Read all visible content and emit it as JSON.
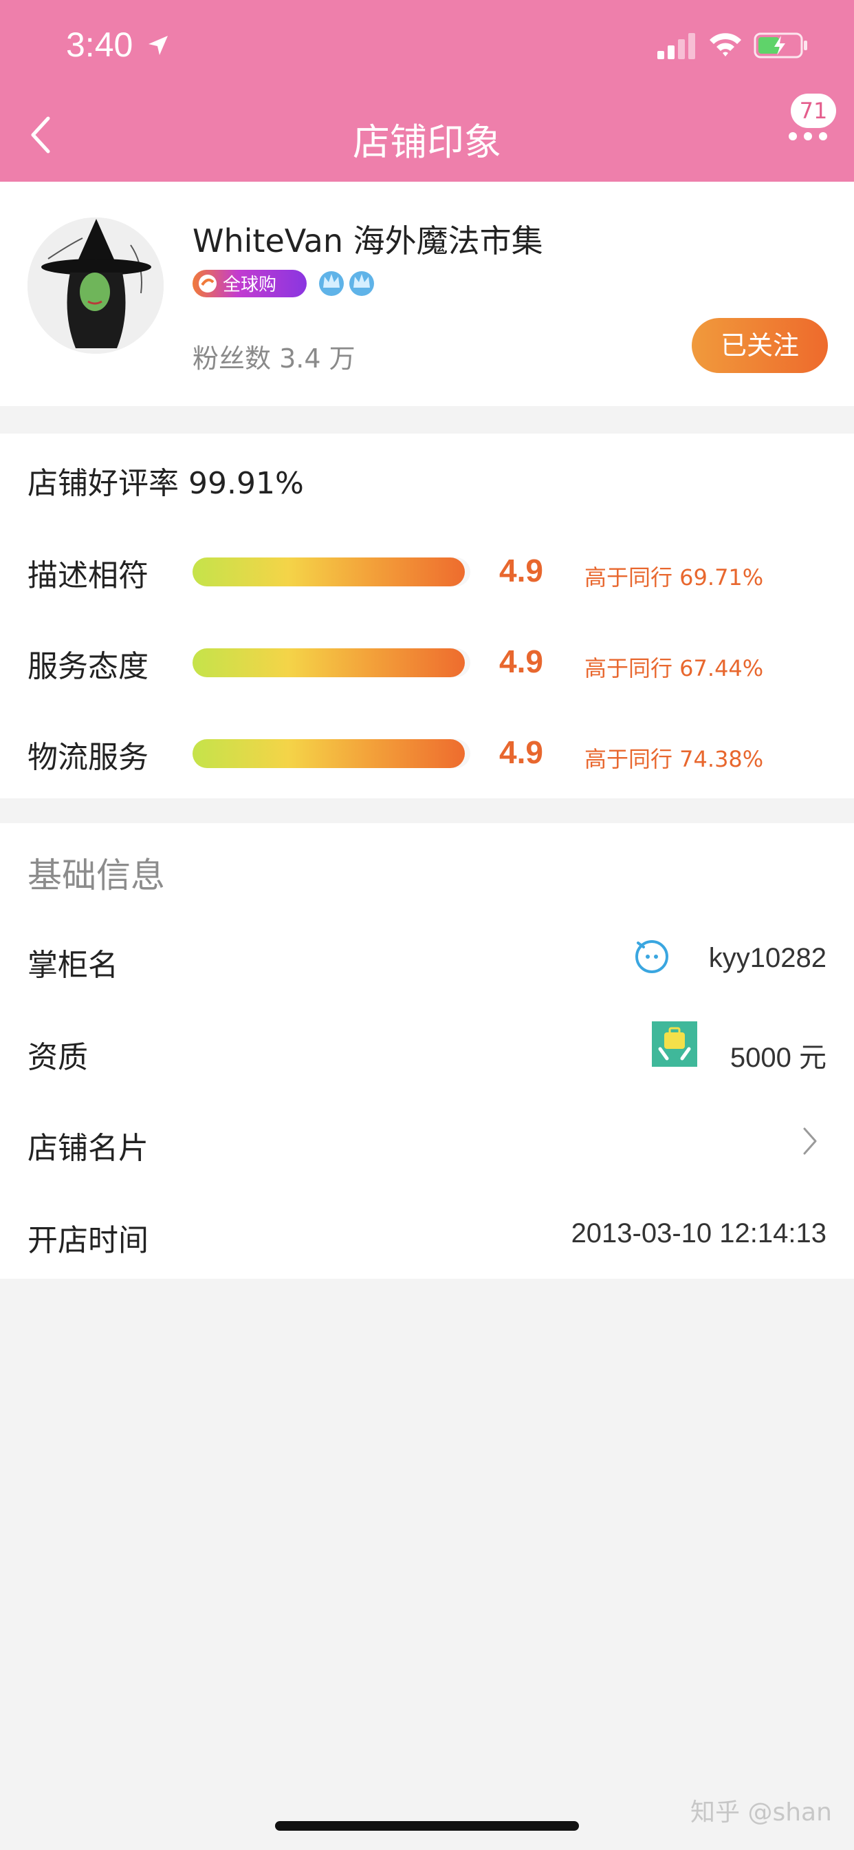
{
  "status_bar": {
    "time": "3:40"
  },
  "nav": {
    "title": "店铺印象",
    "badge_count": "71"
  },
  "shop": {
    "name": "WhiteVan 海外魔法市集",
    "badge_label": "全球购",
    "fans": "粉丝数 3.4 万",
    "follow_label": "已关注"
  },
  "ratings": {
    "good_rate": "店铺好评率 99.91%",
    "items": [
      {
        "label": "描述相符",
        "score": "4.9",
        "compare": "高于同行 69.71%",
        "fill_fraction": 0.98
      },
      {
        "label": "服务态度",
        "score": "4.9",
        "compare": "高于同行 67.44%",
        "fill_fraction": 0.98
      },
      {
        "label": "物流服务",
        "score": "4.9",
        "compare": "高于同行 74.38%",
        "fill_fraction": 0.98
      }
    ]
  },
  "basic_info": {
    "title": "基础信息",
    "rows": [
      {
        "label": "掌柜名",
        "value": "kyy10282",
        "icon": "wangwang-icon"
      },
      {
        "label": "资质",
        "value": "5000 元",
        "icon": "deposit-icon"
      },
      {
        "label": "店铺名片",
        "value": "",
        "icon": "chevron-right-icon"
      },
      {
        "label": "开店时间",
        "value": "2013-03-10 12:14:13"
      }
    ]
  },
  "watermark": "知乎 @shan",
  "colors": {
    "header": "#ee7fab",
    "accent": "#e8672e",
    "follow": "#ee6a2c"
  }
}
